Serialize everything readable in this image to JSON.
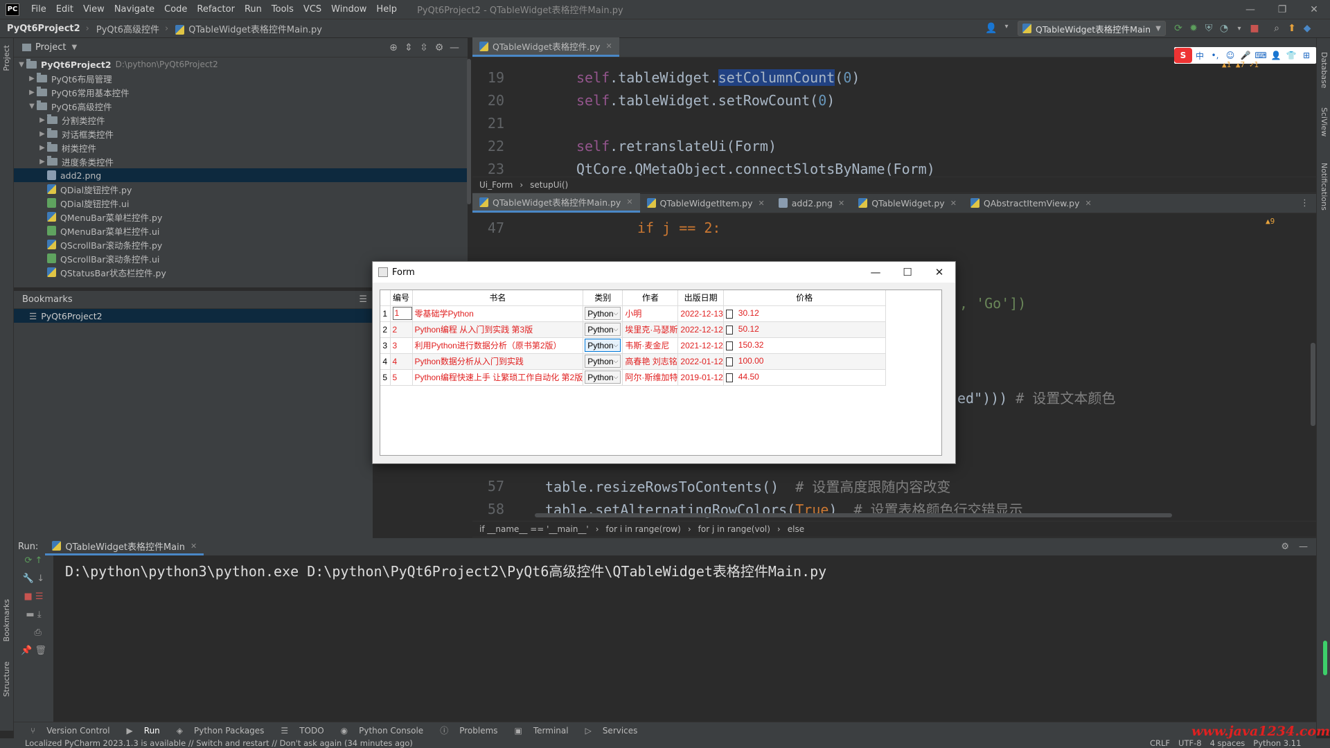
{
  "menubar": {
    "logo": "PC",
    "items": [
      "File",
      "Edit",
      "View",
      "Navigate",
      "Code",
      "Refactor",
      "Run",
      "Tools",
      "VCS",
      "Window",
      "Help"
    ],
    "window_title": "PyQt6Project2 - QTableWidget表格控件Main.py",
    "window_controls": [
      "—",
      "❐",
      "✕"
    ]
  },
  "navbar": {
    "crumbs": [
      "PyQt6Project2",
      "PyQt6高级控件",
      "QTableWidget表格控件Main.py"
    ],
    "run_config": "QTableWidget表格控件Main"
  },
  "left_strip": {
    "project": "Project",
    "bookmarks": "Bookmarks",
    "structure": "Structure"
  },
  "right_strip": {
    "database": "Database",
    "sciview": "SciView",
    "notifications": "Notifications"
  },
  "project_panel": {
    "title": "Project",
    "root": {
      "name": "PyQt6Project2",
      "path": "D:\\python\\PyQt6Project2"
    },
    "items": [
      {
        "label": "PyQt6布局管理",
        "type": "folder",
        "depth": 1,
        "state": "collapsed"
      },
      {
        "label": "PyQt6常用基本控件",
        "type": "folder",
        "depth": 1,
        "state": "collapsed"
      },
      {
        "label": "PyQt6高级控件",
        "type": "folder",
        "depth": 1,
        "state": "expanded"
      },
      {
        "label": "分割类控件",
        "type": "folder",
        "depth": 2,
        "state": "collapsed"
      },
      {
        "label": "对话框类控件",
        "type": "folder",
        "depth": 2,
        "state": "collapsed"
      },
      {
        "label": "树类控件",
        "type": "folder",
        "depth": 2,
        "state": "collapsed"
      },
      {
        "label": "进度条类控件",
        "type": "folder",
        "depth": 2,
        "state": "collapsed"
      },
      {
        "label": "add2.png",
        "type": "png",
        "depth": 2,
        "selected": true
      },
      {
        "label": "QDial旋钮控件.py",
        "type": "py",
        "depth": 2
      },
      {
        "label": "QDial旋钮控件.ui",
        "type": "ui",
        "depth": 2
      },
      {
        "label": "QMenuBar菜单栏控件.py",
        "type": "py",
        "depth": 2
      },
      {
        "label": "QMenuBar菜单栏控件.ui",
        "type": "ui",
        "depth": 2
      },
      {
        "label": "QScrollBar滚动条控件.py",
        "type": "py",
        "depth": 2
      },
      {
        "label": "QScrollBar滚动条控件.ui",
        "type": "ui",
        "depth": 2
      },
      {
        "label": "QStatusBar状态栏控件.py",
        "type": "py",
        "depth": 2
      }
    ]
  },
  "bookmarks_panel": {
    "title": "Bookmarks",
    "item": "PyQt6Project2"
  },
  "editor_top": {
    "tab": "QTableWidget表格控件.py",
    "lines": [
      {
        "n": "19",
        "code": [
          [
            "self",
            "self"
          ],
          [
            ".tableWidget.",
            ""
          ],
          [
            "setColumnCount",
            "hl"
          ],
          [
            "(",
            ""
          ],
          [
            "0",
            "num"
          ],
          [
            ")",
            ""
          ]
        ]
      },
      {
        "n": "20",
        "code": [
          [
            "self",
            "self"
          ],
          [
            ".tableWidget.setRowCount(",
            ""
          ],
          [
            "0",
            "num"
          ],
          [
            ")",
            ""
          ]
        ]
      },
      {
        "n": "21",
        "code": []
      },
      {
        "n": "22",
        "code": [
          [
            "self",
            "self"
          ],
          [
            ".retranslateUi(Form)",
            ""
          ]
        ]
      },
      {
        "n": "23",
        "code": [
          [
            "QtCore.QMetaObject.connectSlotsByName(Form)",
            ""
          ]
        ]
      }
    ],
    "breadcrumb": [
      "Ui_Form",
      "setupUi()"
    ],
    "warnings": "▲1 ▲7 ✓1"
  },
  "editor_bottom": {
    "tabs": [
      "QTableWidget表格控件Main.py",
      "QTableWidgetItem.py",
      "add2.png",
      "QTableWidget.py",
      "QAbstractItemView.py"
    ],
    "partial": {
      "l47": "if j == 2:",
      "go": ", 'Go'])",
      "color": "ed\")))  ",
      "color_comment": "# 设置文本颜色"
    },
    "lines": [
      {
        "n": "57",
        "code": [
          [
            "table.resizeRowsToContents()  ",
            ""
          ],
          [
            "# 设置高度跟随内容改变",
            "cm"
          ]
        ]
      },
      {
        "n": "58",
        "code": [
          [
            "table.setAlternatingRowColors(",
            ""
          ],
          [
            "True",
            "kw"
          ],
          [
            ")  ",
            ""
          ],
          [
            "# 设置表格颜色行交错显示",
            "cm"
          ]
        ]
      }
    ],
    "breadcrumb": [
      "if __name__ == '__main__'",
      "for i in range(row)",
      "for j in range(vol)",
      "else"
    ],
    "warnings": "▲9"
  },
  "run_panel": {
    "label": "Run:",
    "tab": "QTableWidget表格控件Main",
    "output": "D:\\python\\python3\\python.exe D:\\python\\PyQt6Project2\\PyQt6高级控件\\QTableWidget表格控件Main.py"
  },
  "bottom_tabs": [
    "Version Control",
    "Run",
    "Python Packages",
    "TODO",
    "Python Console",
    "Problems",
    "Terminal",
    "Services"
  ],
  "status": {
    "message": "Localized PyCharm 2023.1.3 is available // Switch and restart // Don't ask again (34 minutes ago)",
    "right": [
      "CRLF",
      "UTF-8",
      "4 spaces",
      "Python 3.11"
    ]
  },
  "watermark": "www.java1234.com",
  "ime_bar": [
    "S",
    "中",
    "•,",
    "☺",
    "🎤",
    "⌨",
    "👤",
    "👕",
    "⊞"
  ],
  "form": {
    "title": "Form",
    "headers": [
      "编号",
      "书名",
      "类别",
      "作者",
      "出版日期",
      "价格"
    ],
    "rows": [
      {
        "rh": "1",
        "id": "1",
        "name": "零基础学Python",
        "cat": "Python",
        "author": "小明",
        "date": "2022-12-13",
        "price": "30.12"
      },
      {
        "rh": "2",
        "id": "2",
        "name": "Python编程 从入门到实践 第3版",
        "cat": "Python",
        "author": "埃里克·马瑟斯",
        "date": "2022-12-12",
        "price": "50.12"
      },
      {
        "rh": "3",
        "id": "3",
        "name": "利用Python进行数据分析（原书第2版）",
        "cat": "Python",
        "author": "韦斯·麦金尼",
        "date": "2021-12-12",
        "price": "150.32"
      },
      {
        "rh": "4",
        "id": "4",
        "name": "Python数据分析从入门到实践",
        "cat": "Python",
        "author": "高春艳 刘志铭",
        "date": "2022-01-12",
        "price": "100.00"
      },
      {
        "rh": "5",
        "id": "5",
        "name": "Python编程快速上手 让繁琐工作自动化 第2版",
        "cat": "Python",
        "author": "阿尔·斯维加特",
        "date": "2019-01-12",
        "price": "44.50"
      }
    ]
  },
  "colors": {
    "accent": "#4a88c7",
    "text_red": "#e02020",
    "bg": "#2b2b2b",
    "panel": "#3c3f41"
  }
}
